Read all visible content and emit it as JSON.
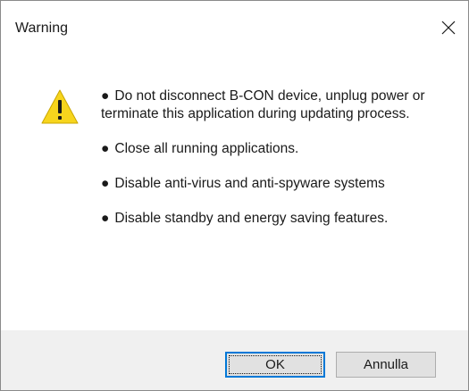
{
  "window": {
    "title": "Warning",
    "close_icon": "close-icon"
  },
  "dialog": {
    "icon": "warning-triangle-icon",
    "icon_color": "#f7d51d",
    "messages": [
      "Do not disconnect B-CON device, unplug power or terminate this application during updating process.",
      "Close all running applications.",
      "Disable anti-virus and anti-spyware systems",
      "Disable standby and energy saving features."
    ],
    "bullet": "●"
  },
  "buttons": {
    "ok_label": "OK",
    "cancel_label": "Annulla"
  },
  "colors": {
    "focus_border": "#0078d7",
    "footer_bg": "#f0f0f0",
    "button_bg": "#e1e1e1"
  }
}
